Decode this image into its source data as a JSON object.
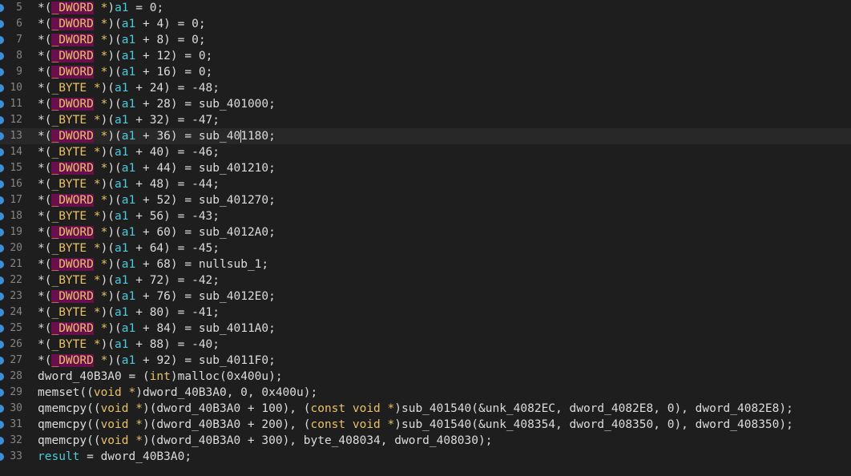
{
  "colors": {
    "background": "#1e1e1e",
    "line_number": "#858585",
    "default_text": "#dcdcdc",
    "type_keyword": "#e8c06a",
    "type_highlight_bg": "#6a0f4c",
    "variable": "#4ec9d9",
    "breakpoint_marker": "#3a8fd6"
  },
  "editor": {
    "current_line_number": "13",
    "lines": [
      {
        "num": "5",
        "tokens": [
          {
            "t": "*("
          },
          {
            "t": "_DWORD",
            "c": "typehl"
          },
          {
            "t": " *",
            "c": "type"
          },
          {
            "t": ")"
          },
          {
            "t": "a1",
            "c": "var"
          },
          {
            "t": " = 0;"
          }
        ]
      },
      {
        "num": "6",
        "tokens": [
          {
            "t": "*("
          },
          {
            "t": "_DWORD",
            "c": "typehl"
          },
          {
            "t": " *",
            "c": "type"
          },
          {
            "t": ")("
          },
          {
            "t": "a1",
            "c": "var"
          },
          {
            "t": " + 4) = 0;"
          }
        ]
      },
      {
        "num": "7",
        "tokens": [
          {
            "t": "*("
          },
          {
            "t": "_DWORD",
            "c": "typehl"
          },
          {
            "t": " *",
            "c": "type"
          },
          {
            "t": ")("
          },
          {
            "t": "a1",
            "c": "var"
          },
          {
            "t": " + 8) = 0;"
          }
        ]
      },
      {
        "num": "8",
        "tokens": [
          {
            "t": "*("
          },
          {
            "t": "_DWORD",
            "c": "typehl"
          },
          {
            "t": " *",
            "c": "type"
          },
          {
            "t": ")("
          },
          {
            "t": "a1",
            "c": "var"
          },
          {
            "t": " + 12) = 0;"
          }
        ]
      },
      {
        "num": "9",
        "tokens": [
          {
            "t": "*("
          },
          {
            "t": "_DWORD",
            "c": "typehl"
          },
          {
            "t": " *",
            "c": "type"
          },
          {
            "t": ")("
          },
          {
            "t": "a1",
            "c": "var"
          },
          {
            "t": " + 16) = 0;"
          }
        ]
      },
      {
        "num": "10",
        "tokens": [
          {
            "t": "*("
          },
          {
            "t": "_BYTE *",
            "c": "type"
          },
          {
            "t": ")("
          },
          {
            "t": "a1",
            "c": "var"
          },
          {
            "t": " + 24) = -48;"
          }
        ]
      },
      {
        "num": "11",
        "tokens": [
          {
            "t": "*("
          },
          {
            "t": "_DWORD",
            "c": "typehl"
          },
          {
            "t": " *",
            "c": "type"
          },
          {
            "t": ")("
          },
          {
            "t": "a1",
            "c": "var"
          },
          {
            "t": " + 28) = sub_401000;"
          }
        ]
      },
      {
        "num": "12",
        "tokens": [
          {
            "t": "*("
          },
          {
            "t": "_BYTE *",
            "c": "type"
          },
          {
            "t": ")("
          },
          {
            "t": "a1",
            "c": "var"
          },
          {
            "t": " + 32) = -47;"
          }
        ]
      },
      {
        "num": "13",
        "tokens": [
          {
            "t": "*("
          },
          {
            "t": "_DWORD",
            "c": "typehl"
          },
          {
            "t": " *",
            "c": "type"
          },
          {
            "t": ")("
          },
          {
            "t": "a1",
            "c": "var"
          },
          {
            "t": " + 36) = sub_40"
          },
          {
            "t": "",
            "c": "caret"
          },
          {
            "t": "1180;"
          }
        ]
      },
      {
        "num": "14",
        "tokens": [
          {
            "t": "*("
          },
          {
            "t": "_BYTE *",
            "c": "type"
          },
          {
            "t": ")("
          },
          {
            "t": "a1",
            "c": "var"
          },
          {
            "t": " + 40) = -46;"
          }
        ]
      },
      {
        "num": "15",
        "tokens": [
          {
            "t": "*("
          },
          {
            "t": "_DWORD",
            "c": "typehl"
          },
          {
            "t": " *",
            "c": "type"
          },
          {
            "t": ")("
          },
          {
            "t": "a1",
            "c": "var"
          },
          {
            "t": " + 44) = sub_401210;"
          }
        ]
      },
      {
        "num": "16",
        "tokens": [
          {
            "t": "*("
          },
          {
            "t": "_BYTE *",
            "c": "type"
          },
          {
            "t": ")("
          },
          {
            "t": "a1",
            "c": "var"
          },
          {
            "t": " + 48) = -44;"
          }
        ]
      },
      {
        "num": "17",
        "tokens": [
          {
            "t": "*("
          },
          {
            "t": "_DWORD",
            "c": "typehl"
          },
          {
            "t": " *",
            "c": "type"
          },
          {
            "t": ")("
          },
          {
            "t": "a1",
            "c": "var"
          },
          {
            "t": " + 52) = sub_401270;"
          }
        ]
      },
      {
        "num": "18",
        "tokens": [
          {
            "t": "*("
          },
          {
            "t": "_BYTE *",
            "c": "type"
          },
          {
            "t": ")("
          },
          {
            "t": "a1",
            "c": "var"
          },
          {
            "t": " + 56) = -43;"
          }
        ]
      },
      {
        "num": "19",
        "tokens": [
          {
            "t": "*("
          },
          {
            "t": "_DWORD",
            "c": "typehl"
          },
          {
            "t": " *",
            "c": "type"
          },
          {
            "t": ")("
          },
          {
            "t": "a1",
            "c": "var"
          },
          {
            "t": " + 60) = sub_4012A0;"
          }
        ]
      },
      {
        "num": "20",
        "tokens": [
          {
            "t": "*("
          },
          {
            "t": "_BYTE *",
            "c": "type"
          },
          {
            "t": ")("
          },
          {
            "t": "a1",
            "c": "var"
          },
          {
            "t": " + 64) = -45;"
          }
        ]
      },
      {
        "num": "21",
        "tokens": [
          {
            "t": "*("
          },
          {
            "t": "_DWORD",
            "c": "typehl"
          },
          {
            "t": " *",
            "c": "type"
          },
          {
            "t": ")("
          },
          {
            "t": "a1",
            "c": "var"
          },
          {
            "t": " + 68) = nullsub_1;"
          }
        ]
      },
      {
        "num": "22",
        "tokens": [
          {
            "t": "*("
          },
          {
            "t": "_BYTE *",
            "c": "type"
          },
          {
            "t": ")("
          },
          {
            "t": "a1",
            "c": "var"
          },
          {
            "t": " + 72) = -42;"
          }
        ]
      },
      {
        "num": "23",
        "tokens": [
          {
            "t": "*("
          },
          {
            "t": "_DWORD",
            "c": "typehl"
          },
          {
            "t": " *",
            "c": "type"
          },
          {
            "t": ")("
          },
          {
            "t": "a1",
            "c": "var"
          },
          {
            "t": " + 76) = sub_4012E0;"
          }
        ]
      },
      {
        "num": "24",
        "tokens": [
          {
            "t": "*("
          },
          {
            "t": "_BYTE *",
            "c": "type"
          },
          {
            "t": ")("
          },
          {
            "t": "a1",
            "c": "var"
          },
          {
            "t": " + 80) = -41;"
          }
        ]
      },
      {
        "num": "25",
        "tokens": [
          {
            "t": "*("
          },
          {
            "t": "_DWORD",
            "c": "typehl"
          },
          {
            "t": " *",
            "c": "type"
          },
          {
            "t": ")("
          },
          {
            "t": "a1",
            "c": "var"
          },
          {
            "t": " + 84) = sub_4011A0;"
          }
        ]
      },
      {
        "num": "26",
        "tokens": [
          {
            "t": "*("
          },
          {
            "t": "_BYTE *",
            "c": "type"
          },
          {
            "t": ")("
          },
          {
            "t": "a1",
            "c": "var"
          },
          {
            "t": " + 88) = -40;"
          }
        ]
      },
      {
        "num": "27",
        "tokens": [
          {
            "t": "*("
          },
          {
            "t": "_DWORD",
            "c": "typehl"
          },
          {
            "t": " *",
            "c": "type"
          },
          {
            "t": ")("
          },
          {
            "t": "a1",
            "c": "var"
          },
          {
            "t": " + 92) = sub_4011F0;"
          }
        ]
      },
      {
        "num": "28",
        "tokens": [
          {
            "t": "dword_40B3A0 = ("
          },
          {
            "t": "int",
            "c": "type"
          },
          {
            "t": ")malloc(0x400u);"
          }
        ]
      },
      {
        "num": "29",
        "tokens": [
          {
            "t": "memset(("
          },
          {
            "t": "void *",
            "c": "type"
          },
          {
            "t": ")dword_40B3A0, 0, 0x400u);"
          }
        ]
      },
      {
        "num": "30",
        "tokens": [
          {
            "t": "qmemcpy(("
          },
          {
            "t": "void *",
            "c": "type"
          },
          {
            "t": ")(dword_40B3A0 + 100), ("
          },
          {
            "t": "const void *",
            "c": "type"
          },
          {
            "t": ")sub_401540(&unk_4082EC, dword_4082E8, 0), dword_4082E8);"
          }
        ]
      },
      {
        "num": "31",
        "tokens": [
          {
            "t": "qmemcpy(("
          },
          {
            "t": "void *",
            "c": "type"
          },
          {
            "t": ")(dword_40B3A0 + 200), ("
          },
          {
            "t": "const void *",
            "c": "type"
          },
          {
            "t": ")sub_401540(&unk_408354, dword_408350, 0), dword_408350);"
          }
        ]
      },
      {
        "num": "32",
        "tokens": [
          {
            "t": "qmemcpy(("
          },
          {
            "t": "void *",
            "c": "type"
          },
          {
            "t": ")(dword_40B3A0 + 300), byte_408034, dword_408030);"
          }
        ]
      },
      {
        "num": "33",
        "tokens": [
          {
            "t": "result",
            "c": "var"
          },
          {
            "t": " = dword_40B3A0;"
          }
        ]
      }
    ]
  }
}
